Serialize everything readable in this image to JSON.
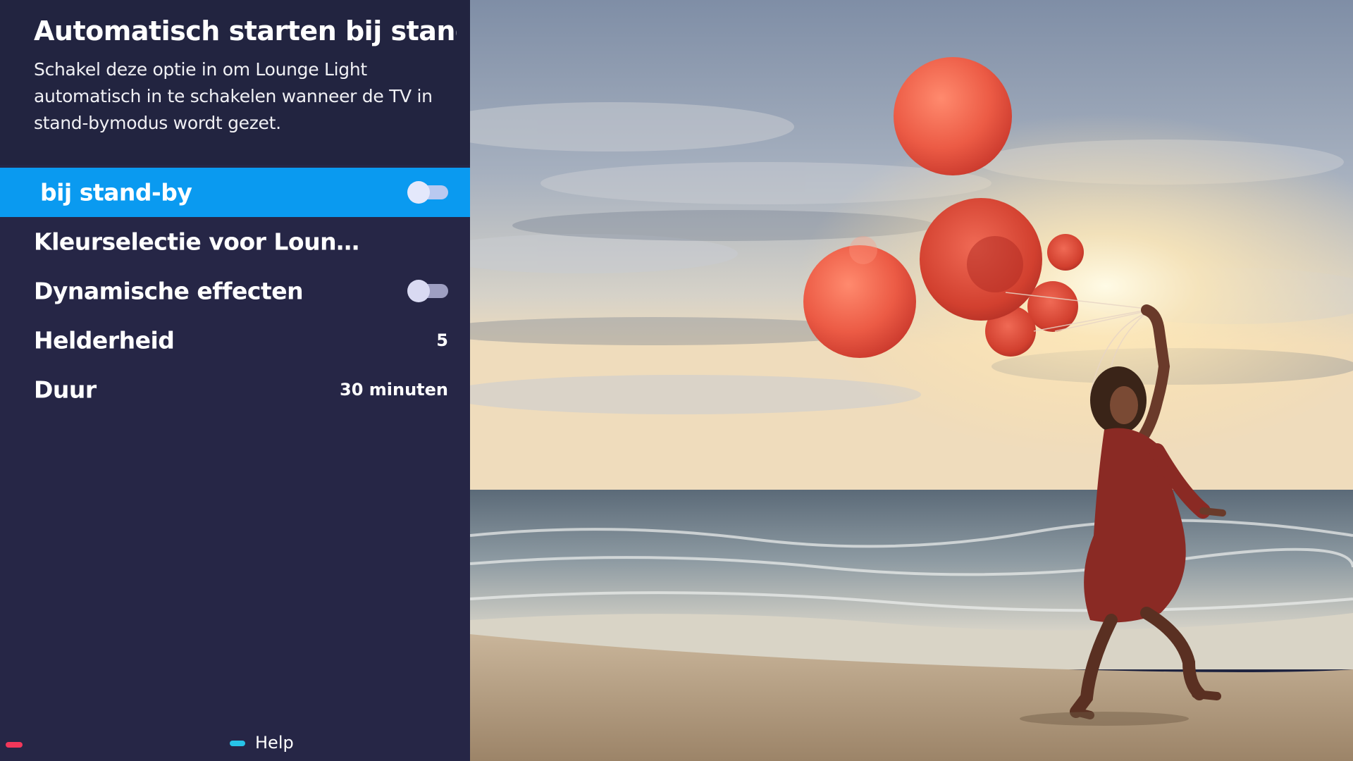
{
  "panel": {
    "title": "Automatisch starten bij stand…",
    "description": "Schakel deze optie in om Lounge Light automatisch in te schakelen wanneer de TV in stand-bymodus wordt gezet.",
    "items": [
      {
        "label": "bij stand-by",
        "type": "toggle",
        "selected": true,
        "state": "off"
      },
      {
        "label": "Kleurselectie voor Loun…",
        "type": "submenu"
      },
      {
        "label": "Dynamische effecten",
        "type": "toggle",
        "state": "off"
      },
      {
        "label": "Helderheid",
        "type": "value",
        "value": "5"
      },
      {
        "label": "Duur",
        "type": "value",
        "value": "30 minuten"
      }
    ]
  },
  "footer": {
    "red_key_color": "#f2375a",
    "help_key_color": "#27c4e8",
    "help_label": "Help"
  },
  "colors": {
    "panel_background": "#262646",
    "selection": "#0a9af0"
  }
}
